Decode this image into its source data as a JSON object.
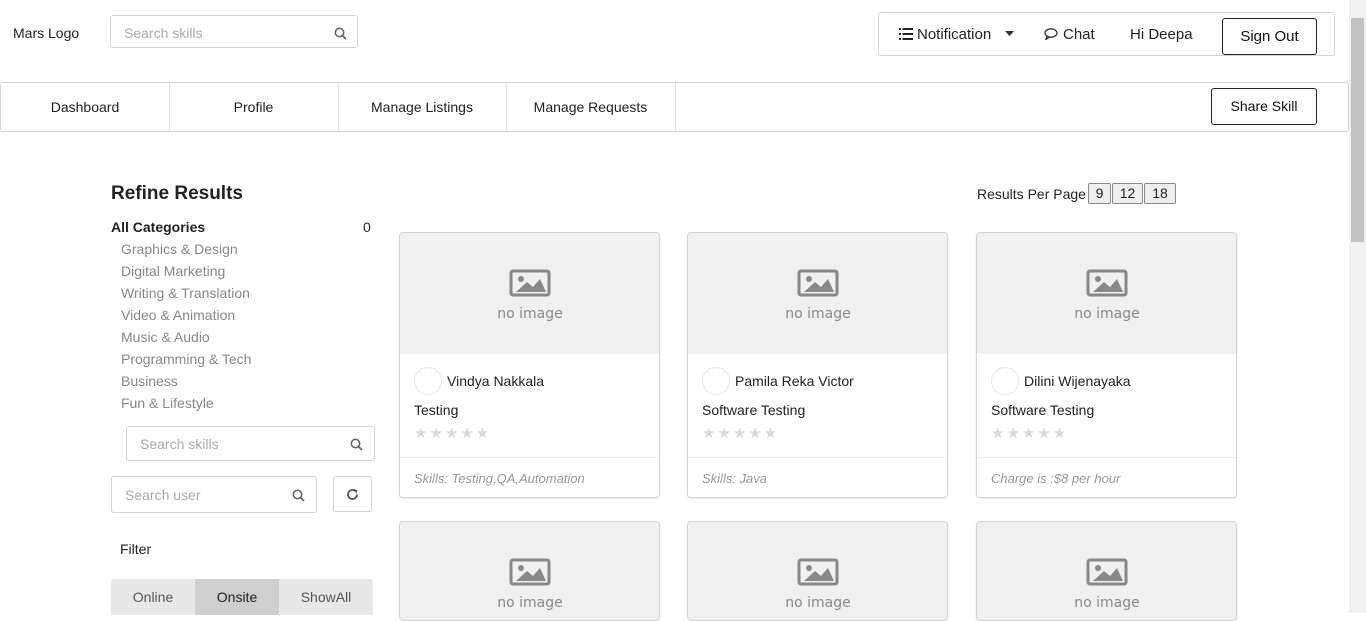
{
  "header": {
    "logo": "Mars Logo",
    "search_placeholder": "Search skills",
    "notification_label": "Notification",
    "chat_label": "Chat",
    "greeting": "Hi Deepa",
    "sign_out_label": "Sign Out"
  },
  "nav": {
    "items": [
      "Dashboard",
      "Profile",
      "Manage Listings",
      "Manage Requests"
    ],
    "share_skill_label": "Share Skill"
  },
  "sidebar": {
    "title": "Refine Results",
    "all_categories_label": "All Categories",
    "all_categories_count": "0",
    "categories": [
      "Graphics & Design",
      "Digital Marketing",
      "Writing & Translation",
      "Video & Animation",
      "Music & Audio",
      "Programming & Tech",
      "Business",
      "Fun & Lifestyle"
    ],
    "search_skills_placeholder": "Search skills",
    "search_user_placeholder": "Search user",
    "filter_label": "Filter",
    "filter_options": [
      "Online",
      "Onsite",
      "ShowAll"
    ],
    "filter_selected": "Onsite"
  },
  "results": {
    "per_page_label": "Results Per Page :",
    "per_page_options": [
      "9",
      "12",
      "18"
    ]
  },
  "cards": [
    {
      "user": "Vindya Nakkala",
      "title": "Testing",
      "footer": "Skills: Testing,QA,Automation",
      "rating": 0
    },
    {
      "user": "Pamila Reka Victor",
      "title": "Software Testing",
      "footer": "Skills: Java",
      "rating": 0
    },
    {
      "user": "Dilini Wijenayaka",
      "title": "Software Testing",
      "footer": "Charge is :$8 per hour",
      "rating": 0
    },
    {
      "user": "",
      "title": "",
      "footer": "",
      "rating": 0
    },
    {
      "user": "",
      "title": "",
      "footer": "",
      "rating": 0
    },
    {
      "user": "",
      "title": "",
      "footer": "",
      "rating": 0
    }
  ],
  "placeholder_image_text": "no image",
  "colors": {
    "border": "#d4d4d5",
    "muted_text": "#888888",
    "active_filter": "#cfcfcf"
  }
}
